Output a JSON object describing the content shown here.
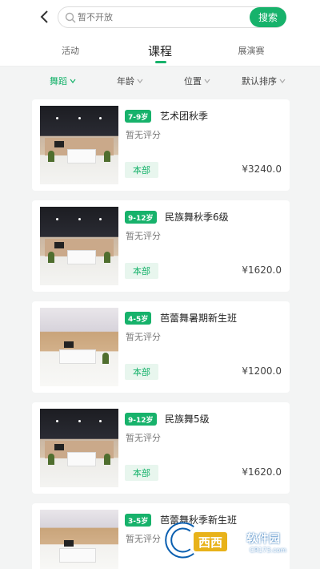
{
  "search": {
    "placeholder": "暂不开放",
    "button_label": "搜索"
  },
  "tabs": [
    {
      "label": "活动"
    },
    {
      "label": "课程"
    },
    {
      "label": "展演赛"
    }
  ],
  "filters": [
    {
      "label": "舞蹈"
    },
    {
      "label": "年龄"
    },
    {
      "label": "位置"
    },
    {
      "label": "默认排序"
    }
  ],
  "courses": [
    {
      "age": "7-9岁",
      "title": "艺术团秋季",
      "rating": "暂无评分",
      "campus": "本部",
      "price": "¥3240.0"
    },
    {
      "age": "9-12岁",
      "title": "民族舞秋季6级",
      "rating": "暂无评分",
      "campus": "本部",
      "price": "¥1620.0"
    },
    {
      "age": "4-5岁",
      "title": "芭蕾舞暑期新生班",
      "rating": "暂无评分",
      "campus": "本部",
      "price": "¥1200.0"
    },
    {
      "age": "9-12岁",
      "title": "民族舞5级",
      "rating": "暂无评分",
      "campus": "本部",
      "price": "¥1620.0"
    },
    {
      "age": "3-5岁",
      "title": "芭蕾舞秋季新生班",
      "rating": "暂无评分",
      "campus": "",
      "price": ""
    }
  ],
  "watermark": {
    "box": "西西",
    "text": "软件园",
    "sub": "CR173.com"
  },
  "colors": {
    "accent": "#17b26b",
    "background": "#f3f4f4"
  }
}
